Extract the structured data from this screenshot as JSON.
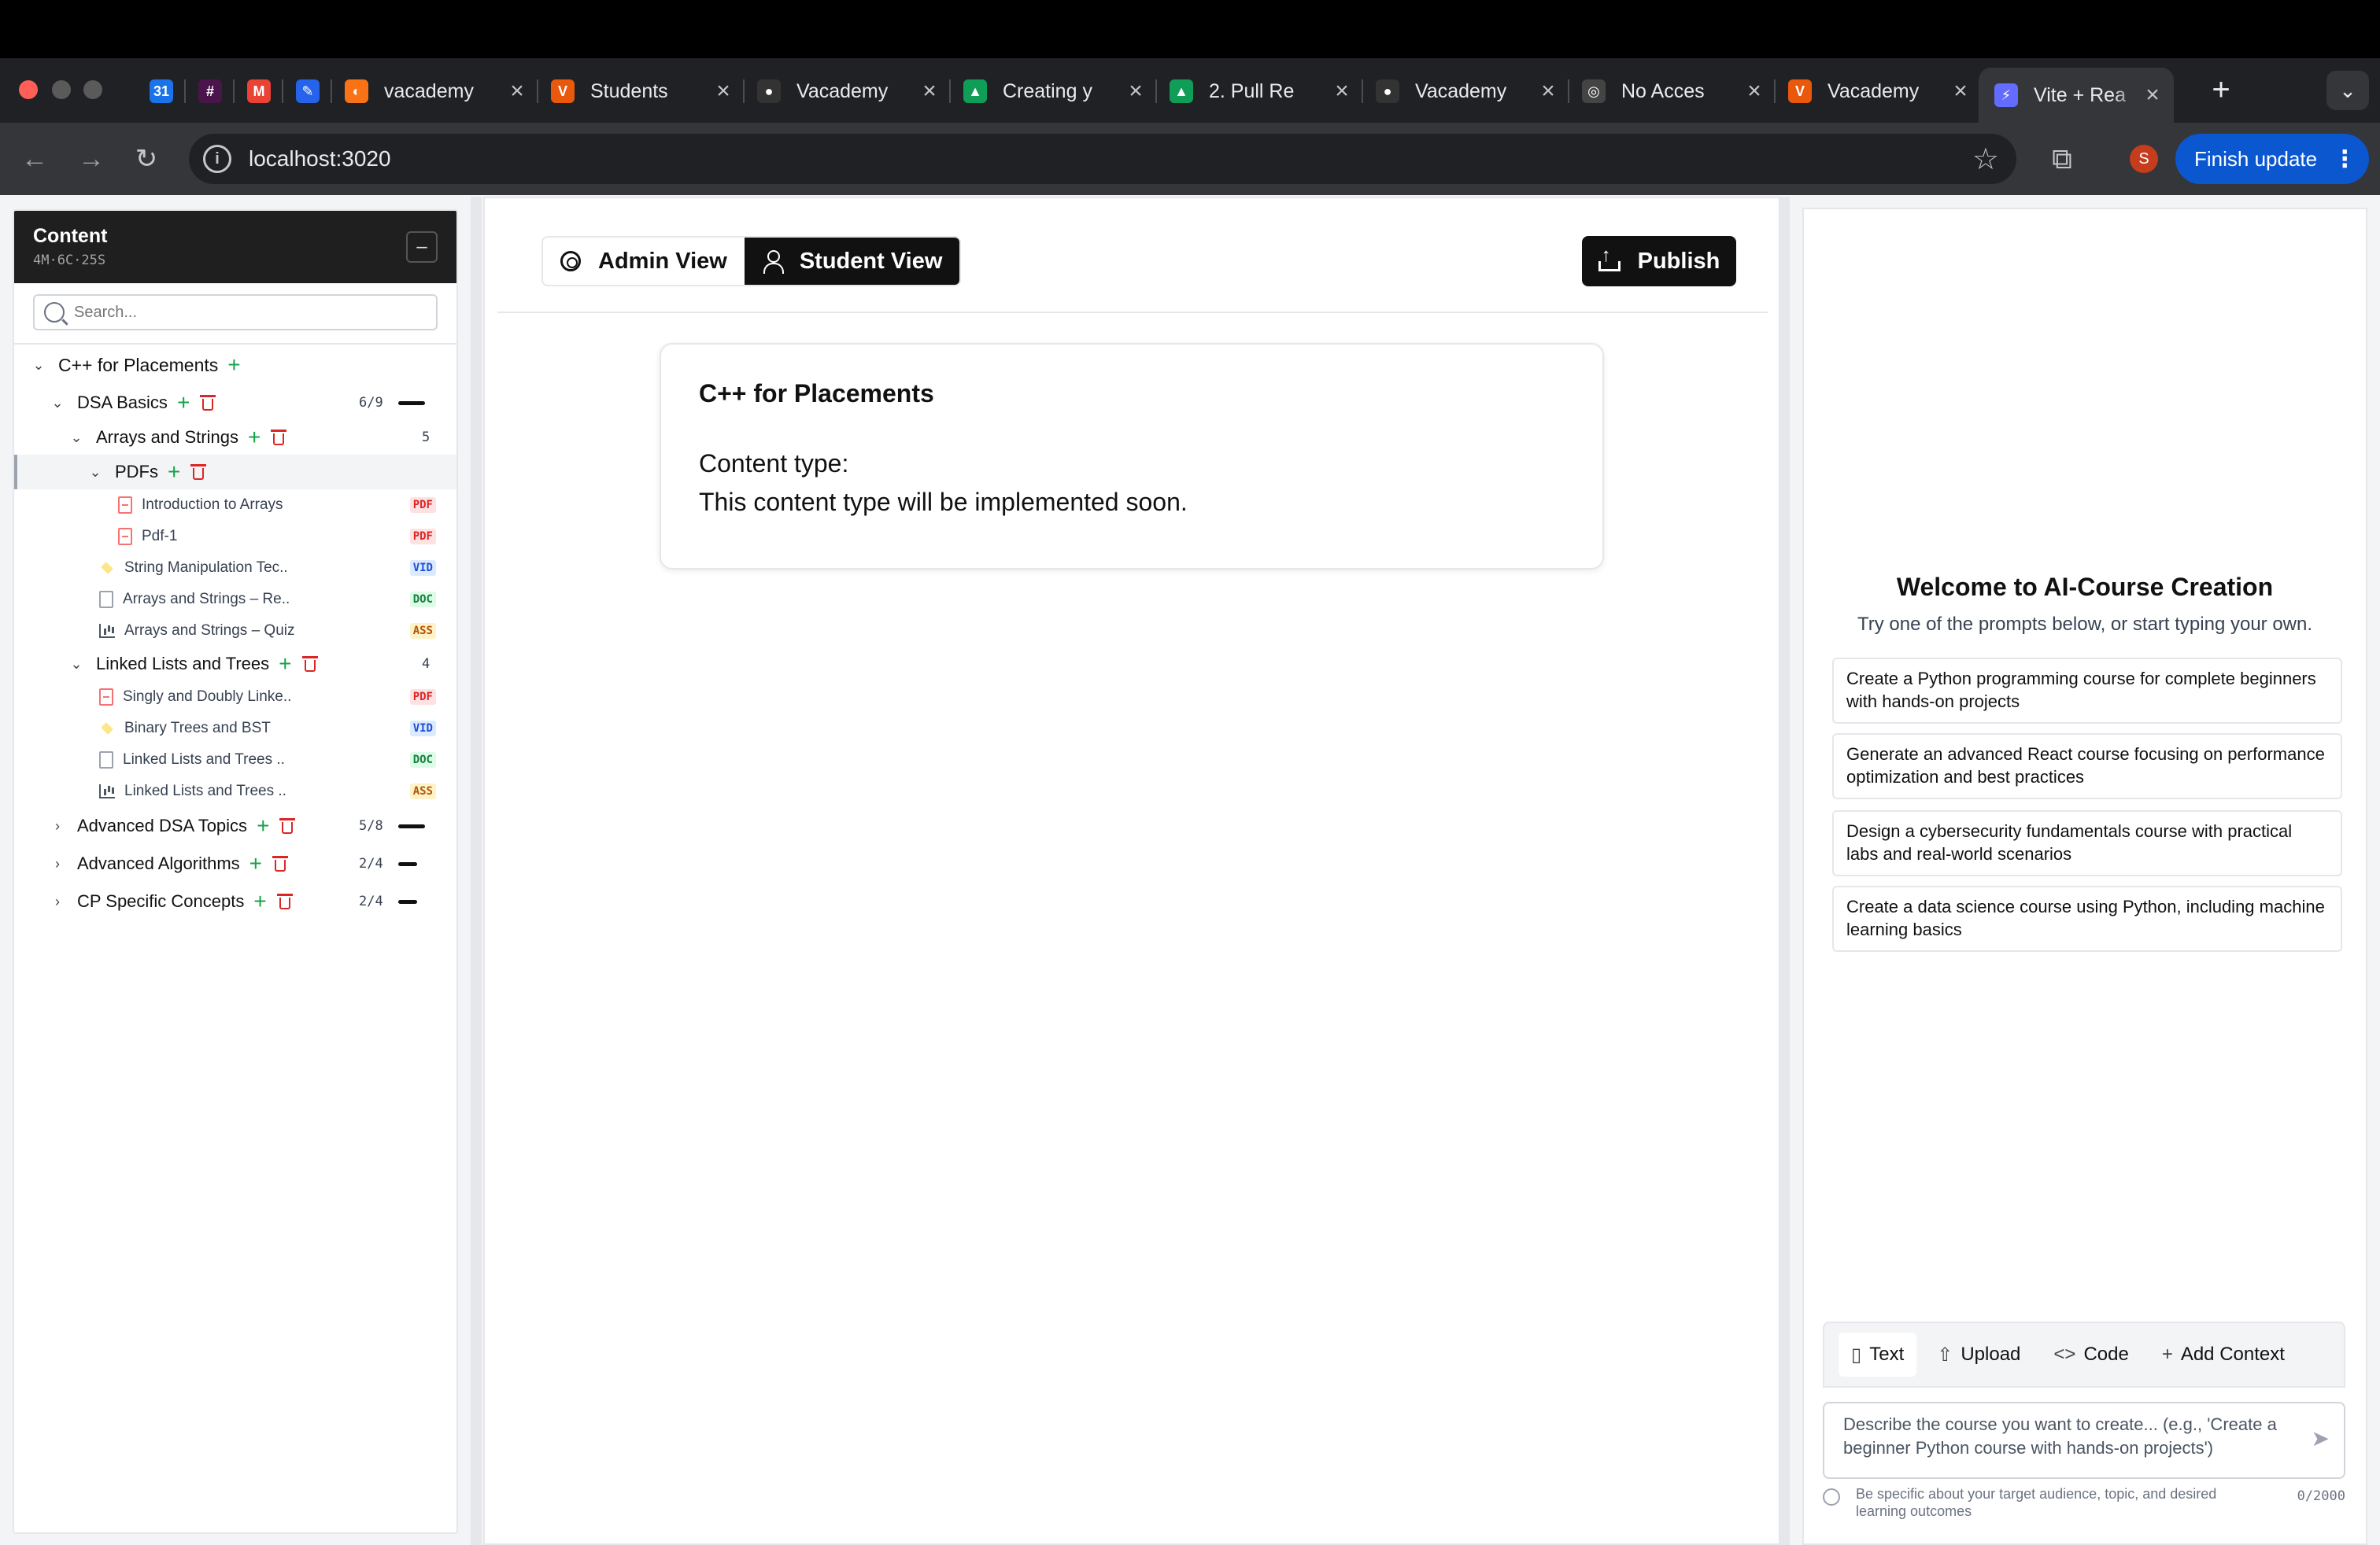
{
  "browser": {
    "tabs": [
      {
        "title": "",
        "icon": "calendar-icon",
        "color": "#1a73e8",
        "glyph": "31"
      },
      {
        "title": "",
        "icon": "slack-icon",
        "color": "#4a154b",
        "glyph": "#"
      },
      {
        "title": "",
        "icon": "gmail-icon",
        "color": "#ea4335",
        "glyph": "M"
      },
      {
        "title": "",
        "icon": "app-icon",
        "color": "#2563eb",
        "glyph": "✎"
      },
      {
        "title": "vacademy",
        "icon": "vacademy-icon",
        "color": "#f97316",
        "glyph": "◐"
      },
      {
        "title": "Students",
        "icon": "vacademy-v-icon",
        "color": "#ea580c",
        "glyph": "V"
      },
      {
        "title": "Vacademy",
        "icon": "github-icon",
        "color": "#333333",
        "glyph": "●"
      },
      {
        "title": "Creating y",
        "icon": "drive-icon",
        "color": "#0f9d58",
        "glyph": "▲"
      },
      {
        "title": "2. Pull Re",
        "icon": "drive-icon",
        "color": "#0f9d58",
        "glyph": "▲"
      },
      {
        "title": "Vacademy",
        "icon": "github-icon",
        "color": "#333333",
        "glyph": "●"
      },
      {
        "title": "No Acces",
        "icon": "openai-icon",
        "color": "#444444",
        "glyph": "◎"
      },
      {
        "title": "Vacademy",
        "icon": "vacademy-v-icon",
        "color": "#ea580c",
        "glyph": "V"
      },
      {
        "title": "Vite + Rea",
        "icon": "vite-icon",
        "color": "#646cff",
        "glyph": "⚡"
      }
    ],
    "url": "localhost:3020",
    "profile_initial": "S",
    "finish_update": "Finish update"
  },
  "sidebar": {
    "title": "Content",
    "subtitle": "4M·6C·25S",
    "collapse_glyph": "–",
    "search_placeholder": "Search...",
    "course": "C++ for Placements",
    "module_dsa": {
      "label": "DSA Basics",
      "count": "6/9"
    },
    "chapter_arrays": {
      "label": "Arrays and Strings",
      "count": "5"
    },
    "folder_pdfs": {
      "label": "PDFs"
    },
    "pdf_items": [
      {
        "label": "Introduction to Arrays",
        "badge": "PDF"
      },
      {
        "label": "Pdf-1",
        "badge": "PDF"
      }
    ],
    "array_items": [
      {
        "label": "String Manipulation Tec..",
        "badge": "VID",
        "type": "vid"
      },
      {
        "label": "Arrays and Strings – Re..",
        "badge": "DOC",
        "type": "doc"
      },
      {
        "label": "Arrays and Strings – Quiz",
        "badge": "ASS",
        "type": "ass"
      }
    ],
    "chapter_linked": {
      "label": "Linked Lists and Trees",
      "count": "4"
    },
    "linked_items": [
      {
        "label": "Singly and Doubly Linke..",
        "badge": "PDF",
        "type": "pdf"
      },
      {
        "label": "Binary Trees and BST",
        "badge": "VID",
        "type": "vid"
      },
      {
        "label": "Linked Lists and Trees ..",
        "badge": "DOC",
        "type": "doc"
      },
      {
        "label": "Linked Lists and Trees ..",
        "badge": "ASS",
        "type": "ass"
      }
    ],
    "modules_collapsed": [
      {
        "label": "Advanced DSA Topics",
        "count": "5/8"
      },
      {
        "label": "Advanced Algorithms",
        "count": "2/4"
      },
      {
        "label": "CP Specific Concepts",
        "count": "2/4"
      }
    ]
  },
  "main": {
    "admin_view": "Admin View",
    "student_view": "Student View",
    "publish": "Publish",
    "card_title": "C++ for Placements",
    "card_type": "Content type:",
    "card_msg": "This content type will be implemented soon."
  },
  "ai": {
    "title": "Welcome to AI-Course Creation",
    "subtitle": "Try one of the prompts below, or start typing your own.",
    "prompts": [
      "Create a Python programming course for complete beginners with hands-on projects",
      "Generate an advanced React course focusing on performance optimization and best practices",
      "Design a cybersecurity fundamentals course with practical labs and real-world scenarios",
      "Create a data science course using Python, including machine learning basics"
    ],
    "tools": {
      "text": "Text",
      "upload": "Upload",
      "code": "Code",
      "context": "Add Context"
    },
    "input_placeholder": "Describe the course you want to create... (e.g., 'Create a beginner Python course with hands-on projects')",
    "hint": "Be specific about your target audience, topic, and desired learning outcomes",
    "char_count": "0/2000"
  },
  "colors": {
    "accent": "#111111",
    "add": "#16a34a",
    "delete": "#dc2626",
    "update": "#0b57d0"
  }
}
